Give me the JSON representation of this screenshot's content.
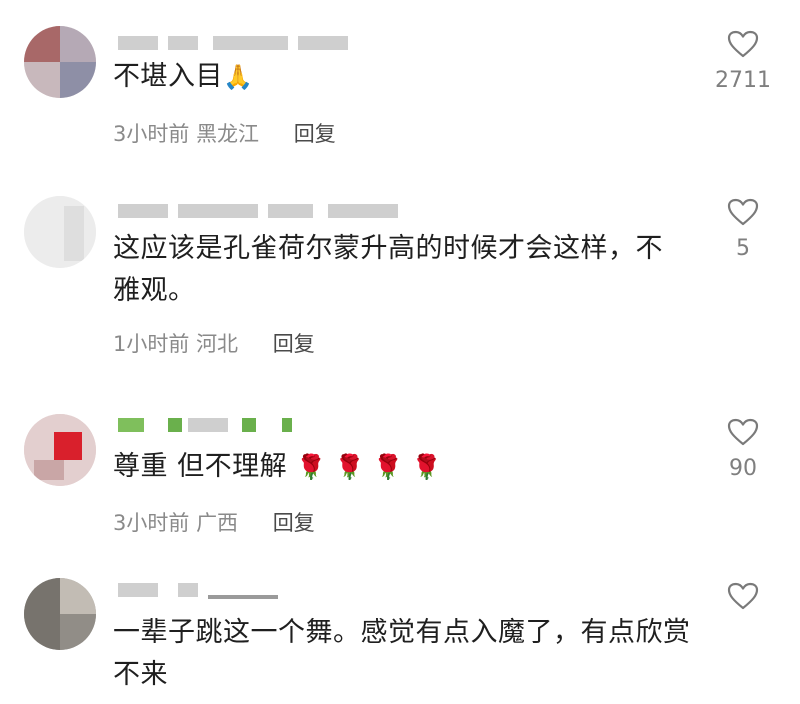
{
  "comments": [
    {
      "text": "不堪入目",
      "emoji": "🙏",
      "time": "3小时前",
      "location": "黑龙江",
      "reply": "回复",
      "likes": "2711"
    },
    {
      "text": "这应该是孔雀荷尔蒙升高的时候才会这样，不雅观。",
      "emoji": "",
      "time": "1小时前",
      "location": "河北",
      "reply": "回复",
      "likes": "5"
    },
    {
      "text": "尊重 但不理解",
      "emoji": "🌹 🌹 🌹 🌹",
      "time": "3小时前",
      "location": "广西",
      "reply": "回复",
      "likes": "90"
    },
    {
      "text": "一辈子跳这一个舞。感觉有点入魔了，有点欣赏不来",
      "emoji": "",
      "time": "",
      "location": "",
      "reply": "",
      "likes": ""
    }
  ],
  "icons": {
    "like": "heart-outline-icon"
  },
  "colors": {
    "meta": "#8a8a8a",
    "like": "#7f7f7f",
    "text": "#1f1f1f"
  }
}
